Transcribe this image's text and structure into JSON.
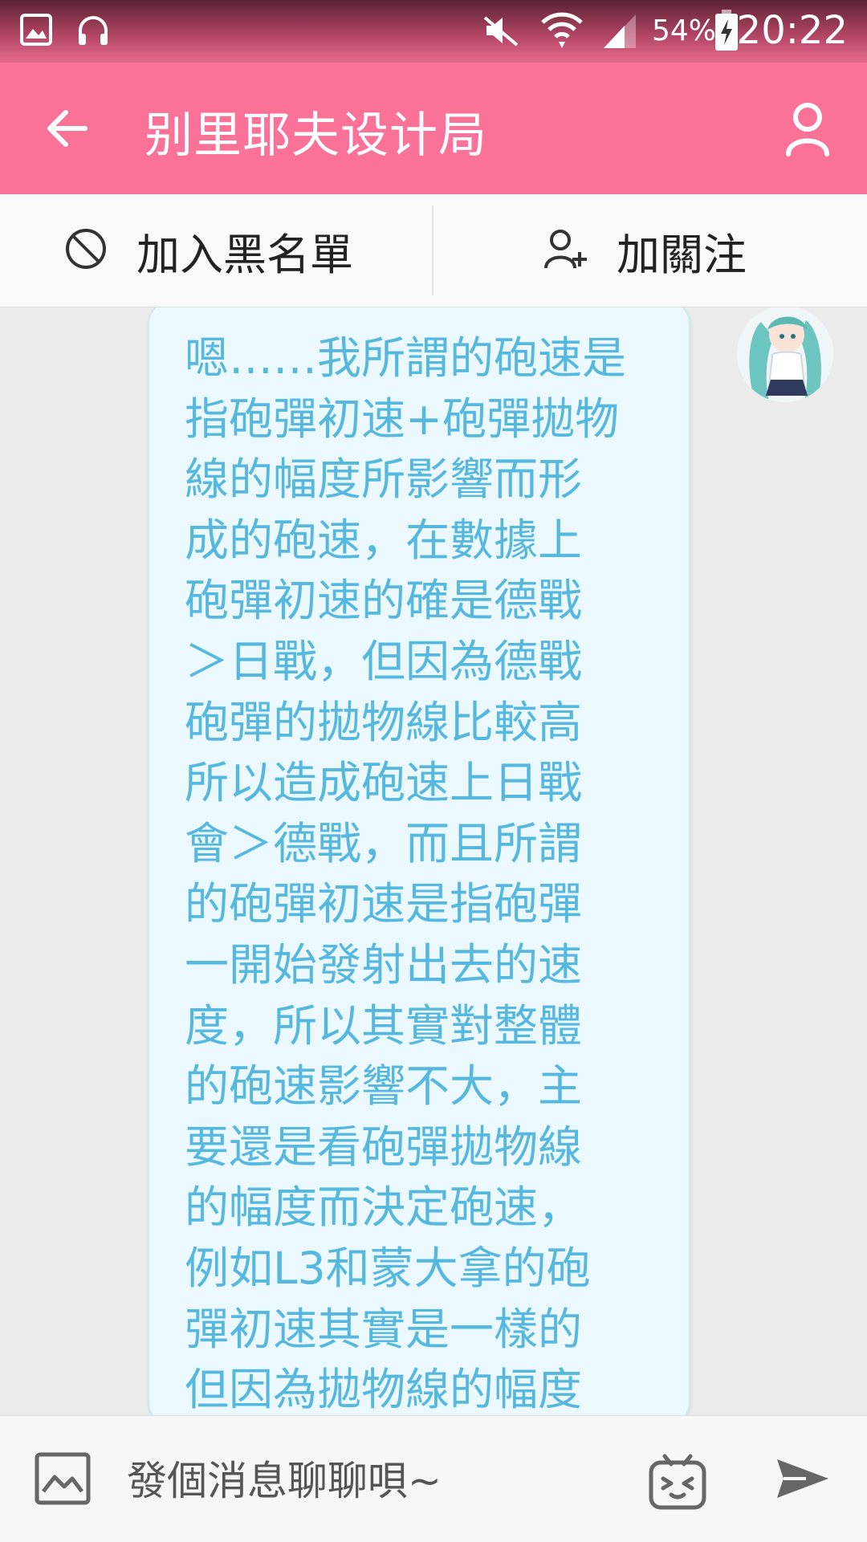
{
  "status_bar": {
    "battery": "54%",
    "time": "20:22"
  },
  "header": {
    "title": "别里耶夫设计局"
  },
  "actions": {
    "block_label": "加入黑名單",
    "follow_label": "加關注"
  },
  "messages": [
    {
      "from": "other",
      "text": "嗯……我所謂的砲速是\n指砲彈初速+砲彈拋物\n線的幅度所影響而形\n成的砲速，在數據上\n砲彈初速的確是德戰\n＞日戰，但因為德戰\n砲彈的拋物線比較高\n所以造成砲速上日戰\n會＞德戰，而且所謂\n的砲彈初速是指砲彈\n一開始發射出去的速\n度，所以其實對整體\n的砲速影響不大，主\n要還是看砲彈拋物線\n的幅度而決定砲速，\n例如L3和蒙大拿的砲\n彈初速其實是一樣的\n但因為拋物線的幅度"
    }
  ],
  "composer": {
    "placeholder": "發個消息聊聊唄~"
  },
  "icons": {
    "gallery": "gallery-icon",
    "headphones": "headphones-icon",
    "mute": "mute-icon",
    "wifi": "wifi-icon",
    "signal": "signal-icon",
    "battery": "battery-charging-icon",
    "back": "back-arrow-icon",
    "profile": "person-icon",
    "block": "block-icon",
    "follow": "add-person-icon",
    "image": "image-icon",
    "emoji": "emoji-icon",
    "send": "send-icon"
  },
  "colors": {
    "header": "#fb7299",
    "bubble_bg": "#ebf9ff",
    "bubble_text": "#56b8df"
  }
}
